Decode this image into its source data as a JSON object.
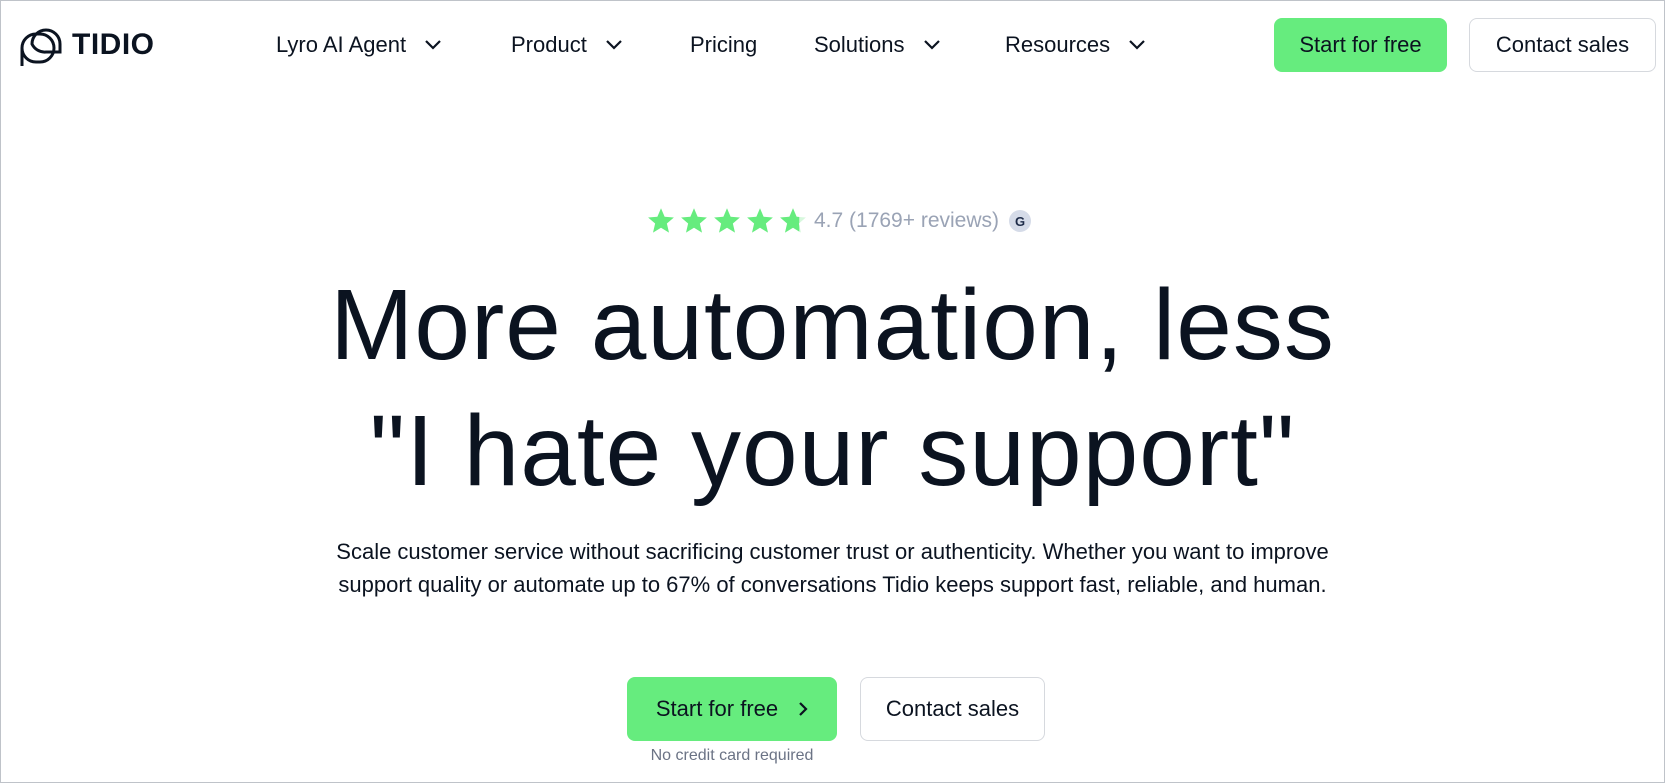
{
  "brand": {
    "name": "TIDIO"
  },
  "nav": {
    "items": [
      {
        "label": "Lyro AI Agent",
        "has_dropdown": true
      },
      {
        "label": "Product",
        "has_dropdown": true
      },
      {
        "label": "Pricing",
        "has_dropdown": false
      },
      {
        "label": "Solutions",
        "has_dropdown": true
      },
      {
        "label": "Resources",
        "has_dropdown": true
      }
    ],
    "cta_primary": "Start for free",
    "cta_secondary": "Contact sales"
  },
  "hero": {
    "rating": {
      "stars": 4.7,
      "text": "4.7 (1769+ reviews)",
      "badge": "G"
    },
    "headline_line1": "More automation, less",
    "headline_line2": "\"I hate your support\"",
    "subtext_line1": "Scale customer service without sacrificing customer trust or authenticity. Whether you want to improve",
    "subtext_line2": "support quality or automate up to 67% of conversations Tidio keeps support fast, reliable, and human.",
    "cta_primary": "Start for free",
    "cta_secondary": "Contact sales",
    "note": "No credit card required"
  },
  "colors": {
    "accent": "#66ec7e",
    "text": "#0b1320",
    "muted": "#9aa3b5"
  }
}
